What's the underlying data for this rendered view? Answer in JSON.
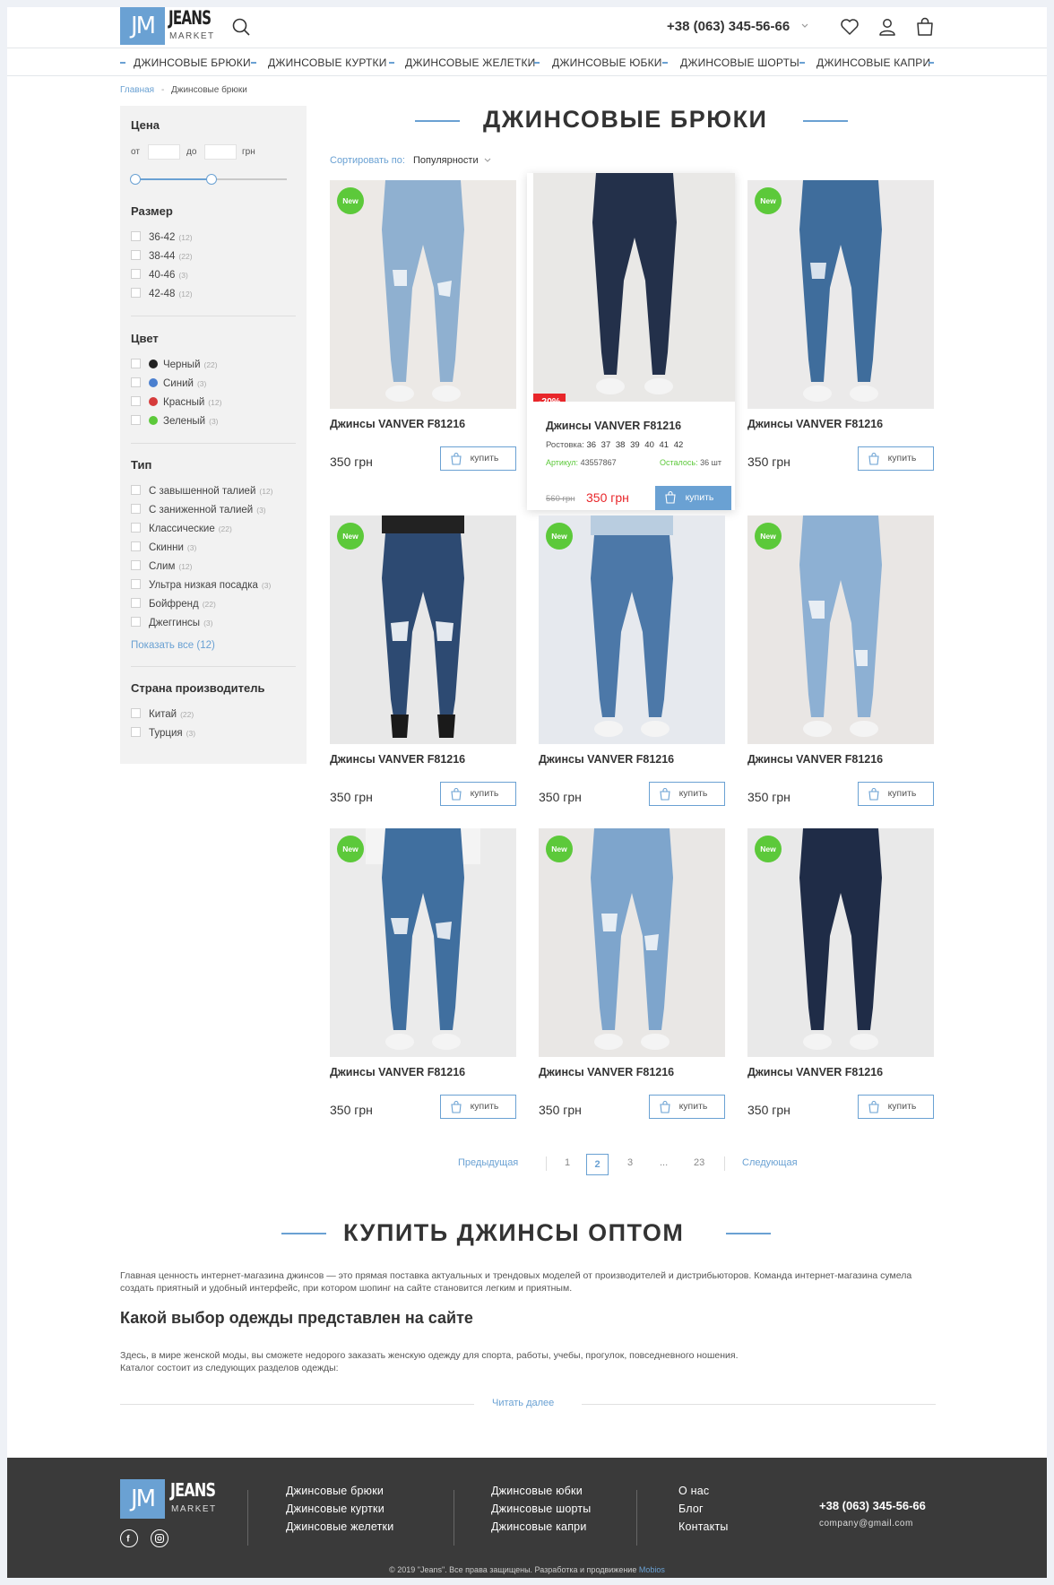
{
  "header": {
    "logo_mark": "JM",
    "logo_word": "JEANS",
    "logo_sub": "MARKET",
    "phone": "+38 (063) 345-56-66"
  },
  "nav": [
    "ДЖИНСОВЫЕ БРЮКИ",
    "ДЖИНСОВЫЕ КУРТКИ",
    "ДЖИНСОВЫЕ ЖЕЛЕТКИ",
    "ДЖИНСОВЫЕ ЮБКИ",
    "ДЖИНСОВЫЕ ШОРТЫ",
    "ДЖИНСОВЫЕ КАПРИ"
  ],
  "breadcrumb": {
    "home": "Главная",
    "separator": "-",
    "current": "Джинсовые брюки"
  },
  "filters": {
    "price": {
      "title": "Цена",
      "from": "от",
      "to": "до",
      "currency": "грн"
    },
    "size": {
      "title": "Размер",
      "items": [
        {
          "label": "36-42",
          "count": "(12)"
        },
        {
          "label": "38-44",
          "count": "(22)"
        },
        {
          "label": "40-46",
          "count": "(3)"
        },
        {
          "label": "42-48",
          "count": "(12)"
        }
      ]
    },
    "color": {
      "title": "Цвет",
      "items": [
        {
          "label": "Черный",
          "count": "(22)",
          "color": "#222222"
        },
        {
          "label": "Синий",
          "count": "(3)",
          "color": "#4a7fcf"
        },
        {
          "label": "Красный",
          "count": "(12)",
          "color": "#d63b3b"
        },
        {
          "label": "Зеленый",
          "count": "(3)",
          "color": "#5cc93a"
        }
      ]
    },
    "type": {
      "title": "Тип",
      "items": [
        {
          "label": "С завышенной талией",
          "count": "(12)"
        },
        {
          "label": "С заниженной талией",
          "count": "(3)"
        },
        {
          "label": "Классические",
          "count": "(22)"
        },
        {
          "label": "Скинни",
          "count": "(3)"
        },
        {
          "label": "Слим",
          "count": "(12)"
        },
        {
          "label": "Ультра низкая посадка",
          "count": "(3)"
        },
        {
          "label": "Бойфренд",
          "count": "(22)"
        },
        {
          "label": "Джеггинсы",
          "count": "(3)"
        }
      ],
      "show_all": "Показать все (12)"
    },
    "country": {
      "title": "Страна производитель",
      "items": [
        {
          "label": "Китай",
          "count": "(22)"
        },
        {
          "label": "Турция",
          "count": "(3)"
        }
      ]
    }
  },
  "main": {
    "title": "ДЖИНСОВЫЕ БРЮКИ",
    "sort_label": "Сортировать по:",
    "sort_value": "Популярности"
  },
  "product": {
    "name": "Джинсы VANVER F81216",
    "price": "350 грн",
    "buy": "купить",
    "badge": "New"
  },
  "highlight": {
    "discount": "-20%",
    "sizes_label": "Ростовка:",
    "sizes": "36  37  38  39  40  41  42",
    "sku_label": "Артикул:",
    "sku": "43557867",
    "stock_label": "Осталось:",
    "stock": "36 шт",
    "old_price": "560 грн",
    "new_price": "350 грн"
  },
  "pagination": {
    "prev": "Предыдущая",
    "pages": [
      "1",
      "2",
      "3",
      "...",
      "23"
    ],
    "next": "Следующая"
  },
  "seo": {
    "title": "КУПИТЬ ДЖИНСЫ ОПТОМ",
    "p1": "Главная ценность интернет-магазина джинсов — это прямая поставка актуальных и трендовых моделей от производителей и дистрибьюторов. Команда интернет-магазина сумела создать приятный и удобный интерфейс, при котором шопинг на сайте становится легким и приятным.",
    "subtitle": "Какой выбор одежды представлен на сайте",
    "p2": "Здесь, в мире женской моды, вы сможете недорого заказать женскую одежду для спорта, работы, учебы, прогулок, повседневного ношения.",
    "p3": "Каталог состоит из следующих разделов одежды:",
    "read_more": "Читать далее"
  },
  "footer": {
    "col1": [
      "Джинсовые брюки",
      "Джинсовые куртки",
      "Джинсовые желетки"
    ],
    "col2": [
      "Джинсовые юбки",
      "Джинсовые шорты",
      "Джинсовые капри"
    ],
    "col3": [
      "О нас",
      "Блог",
      "Контакты"
    ],
    "phone": "+38 (063) 345-56-66",
    "email": "company@gmail.com",
    "copyright": "© 2019 \"Jeans\". Все права защищены. Разработка и продвижение",
    "dev": "Mobios"
  },
  "colors": {
    "accent": "#6aa1d3",
    "new_badge": "#5cc93a",
    "sale": "#e8262a",
    "footer_bg": "#3a3a3a"
  }
}
